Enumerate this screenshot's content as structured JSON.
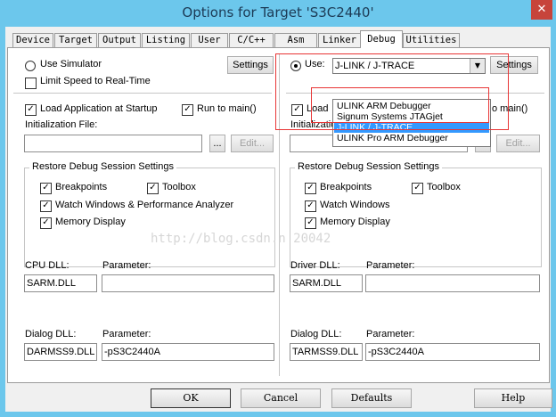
{
  "window": {
    "title": "Options for Target 'S3C2440'",
    "close_glyph": "✕",
    "accent_color": "#6cc7ec",
    "close_color": "#c7443b"
  },
  "tabs": [
    {
      "label": "Device"
    },
    {
      "label": "Target"
    },
    {
      "label": "Output"
    },
    {
      "label": "Listing"
    },
    {
      "label": "User"
    },
    {
      "label": "C/C++"
    },
    {
      "label": "Asm"
    },
    {
      "label": "Linker"
    },
    {
      "label": "Debug",
      "active": true
    },
    {
      "label": "Utilities"
    }
  ],
  "left": {
    "use_simulator": {
      "label": "Use Simulator",
      "selected": false
    },
    "settings_label": "Settings",
    "limit_speed": {
      "label": "Limit Speed to Real-Time",
      "checked": false
    },
    "load_app": {
      "label": "Load Application at Startup",
      "checked": true
    },
    "run_to_main": {
      "label": "Run to main()",
      "checked": true
    },
    "init_file_label": "Initialization File:",
    "init_file_value": "",
    "browse_label": "...",
    "edit_label": "Edit...",
    "restore": {
      "title": "Restore Debug Session Settings",
      "breakpoints": "Breakpoints",
      "toolbox": "Toolbox",
      "watch": "Watch Windows & Performance Analyzer",
      "memory": "Memory Display"
    },
    "cpu_dll_label": "CPU DLL:",
    "cpu_dll_value": "SARM.DLL",
    "cpu_param_label": "Parameter:",
    "cpu_param_value": "",
    "dialog_dll_label": "Dialog DLL:",
    "dialog_dll_value": "DARMSS9.DLL",
    "dialog_param_label": "Parameter:",
    "dialog_param_value": "-pS3C2440A"
  },
  "right": {
    "use": {
      "label": "Use:",
      "selected": true
    },
    "debugger_selected": "J-LINK / J-TRACE",
    "settings_label": "Settings",
    "dropdown_options": [
      "ULINK ARM Debugger",
      "Signum Systems JTAGjet",
      "J-LINK / J-TRACE",
      "ULINK Pro ARM Debugger"
    ],
    "dropdown_selected_index": 2,
    "load_partial": "Load",
    "run_to_main_partial": "o main()",
    "init_file_label": "Initialization File:",
    "init_file_value": "",
    "browse_label": "...",
    "edit_label": "Edit...",
    "restore": {
      "title": "Restore Debug Session Settings",
      "breakpoints": "Breakpoints",
      "toolbox": "Toolbox",
      "watch": "Watch Windows",
      "memory": "Memory Display"
    },
    "driver_dll_label": "Driver DLL:",
    "driver_dll_value": "SARM.DLL",
    "driver_param_label": "Parameter:",
    "driver_param_value": "",
    "dialog_dll_label": "Dialog DLL:",
    "dialog_dll_value": "TARMSS9.DLL",
    "dialog_param_label": "Parameter:",
    "dialog_param_value": "-pS3C2440A"
  },
  "watermark": "http://blog.csdn.n    20042",
  "buttons": {
    "ok": "OK",
    "cancel": "Cancel",
    "defaults": "Defaults",
    "help": "Help"
  },
  "highlight_color": "#e83535",
  "selection_color": "#3399ff"
}
